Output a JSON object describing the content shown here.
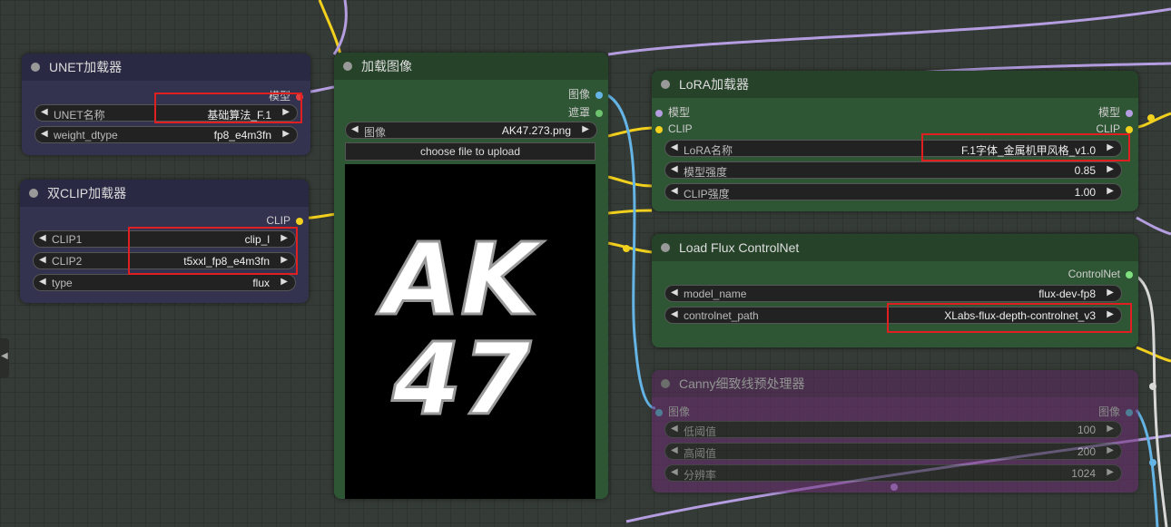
{
  "colors": {
    "clip_wire": "#f2d01e",
    "model_wire": "#b49de0",
    "image_wire": "#64b4e6",
    "control_wire": "#e0e0e0",
    "highlight": "#e02020"
  },
  "unet_loader": {
    "title": "UNET加载器",
    "output_label": "模型",
    "widgets": [
      {
        "label": "UNET名称",
        "value": "基础算法_F.1"
      },
      {
        "label": "weight_dtype",
        "value": "fp8_e4m3fn"
      }
    ]
  },
  "dual_clip_loader": {
    "title": "双CLIP加载器",
    "output_label": "CLIP",
    "widgets": [
      {
        "label": "CLIP1",
        "value": "clip_l"
      },
      {
        "label": "CLIP2",
        "value": "t5xxl_fp8_e4m3fn"
      },
      {
        "label": "type",
        "value": "flux"
      }
    ]
  },
  "load_image": {
    "title": "加载图像",
    "outputs": [
      "图像",
      "遮罩"
    ],
    "widget": {
      "label": "图像",
      "value": "AK47.273.png"
    },
    "upload_button": "choose file to upload",
    "preview_text": [
      "AK",
      "47"
    ]
  },
  "lora_loader": {
    "title": "LoRA加载器",
    "inputs": [
      "模型",
      "CLIP"
    ],
    "outputs": [
      "模型",
      "CLIP"
    ],
    "widgets": [
      {
        "label": "LoRA名称",
        "value": "F.1字体_金属机甲风格_v1.0"
      },
      {
        "label": "模型强度",
        "value": "0.85"
      },
      {
        "label": "CLIP强度",
        "value": "1.00"
      }
    ]
  },
  "flux_controlnet": {
    "title": "Load Flux ControlNet",
    "output_label": "ControlNet",
    "widgets": [
      {
        "label": "model_name",
        "value": "flux-dev-fp8"
      },
      {
        "label": "controlnet_path",
        "value": "XLabs-flux-depth-controlnet_v3"
      }
    ]
  },
  "canny": {
    "title": "Canny细致线预处理器",
    "input_label": "图像",
    "output_label": "图像",
    "widgets": [
      {
        "label": "低阈值",
        "value": "100"
      },
      {
        "label": "高阈值",
        "value": "200"
      },
      {
        "label": "分辨率",
        "value": "1024"
      }
    ]
  },
  "side_tab_icon": "chevron-left-icon"
}
